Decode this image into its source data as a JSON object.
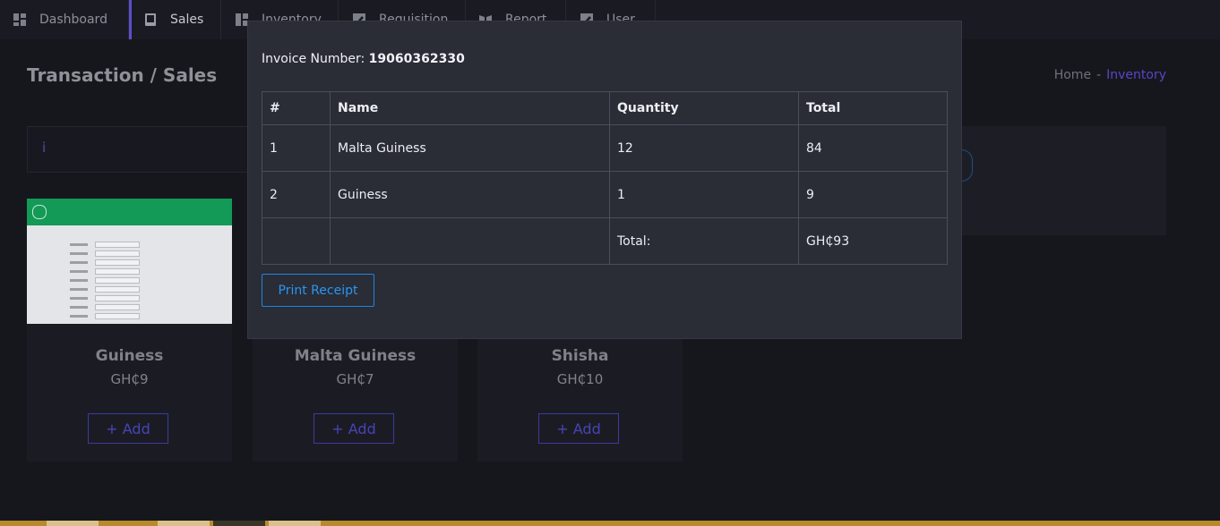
{
  "nav": {
    "items": [
      {
        "label": "Dashboard",
        "icon": "dashboard-icon"
      },
      {
        "label": "Sales",
        "icon": "tablet-icon"
      },
      {
        "label": "Inventory",
        "icon": "layout-icon"
      },
      {
        "label": "Requisition",
        "icon": "edit-icon"
      },
      {
        "label": "Report",
        "icon": "book-icon"
      },
      {
        "label": "User",
        "icon": "edit-icon"
      }
    ]
  },
  "page": {
    "title": "Transaction / Sales",
    "breadcrumb": {
      "home": "Home",
      "separator": "-",
      "current": "Inventory"
    }
  },
  "search": {
    "value": "i"
  },
  "products": [
    {
      "name": "Guiness",
      "price": "GH₵9",
      "add_label": "+ Add"
    },
    {
      "name": "Malta Guiness",
      "price": "GH₵7",
      "add_label": "+ Add"
    },
    {
      "name": "Shisha",
      "price": "GH₵10",
      "add_label": "+ Add"
    }
  ],
  "modal": {
    "invoice_label": "Invoice Number:",
    "invoice_number": "19060362330",
    "columns": [
      "#",
      "Name",
      "Quantity",
      "Total"
    ],
    "rows": [
      {
        "num": "1",
        "name": "Malta Guiness",
        "qty": "12",
        "total": "84"
      },
      {
        "num": "2",
        "name": "Guiness",
        "qty": "1",
        "total": "9"
      }
    ],
    "total_label": "Total:",
    "total_value": "GH₵93",
    "print_label": "Print Receipt"
  },
  "colors": {
    "accent": "#5547c7",
    "modal_bg": "#2a2c36",
    "print_blue": "#2996f2"
  }
}
